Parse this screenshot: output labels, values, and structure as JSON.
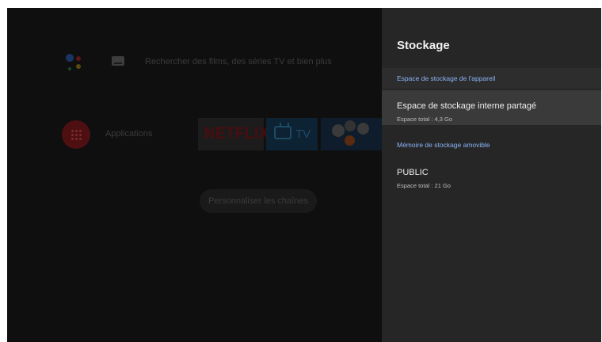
{
  "home": {
    "search_text": "Rechercher des films, des séries TV et bien plus",
    "apps_label": "Applications",
    "tiles": {
      "netflix": "NETFLIX",
      "tv": "TV"
    },
    "customize_label": "Personnaliser les chaînes"
  },
  "panel": {
    "title": "Stockage",
    "sections": [
      {
        "header": "Espace de stockage de l'appareil",
        "items": [
          {
            "title": "Espace de stockage interne partagé",
            "subtitle": "Espace total : 4,3 Go",
            "focused": true
          }
        ]
      },
      {
        "header": "Mémoire de stockage amovible",
        "items": [
          {
            "title": "PUBLIC",
            "subtitle": "Espace total : 21 Go",
            "focused": false
          }
        ]
      }
    ]
  },
  "colors": {
    "accent_header": "#8ab4f8",
    "panel_bg": "#262626",
    "focused_row": "#3a3a3a"
  },
  "icons": [
    "google-assistant-icon",
    "keyboard-icon",
    "apps-grid-icon",
    "tv-icon"
  ]
}
